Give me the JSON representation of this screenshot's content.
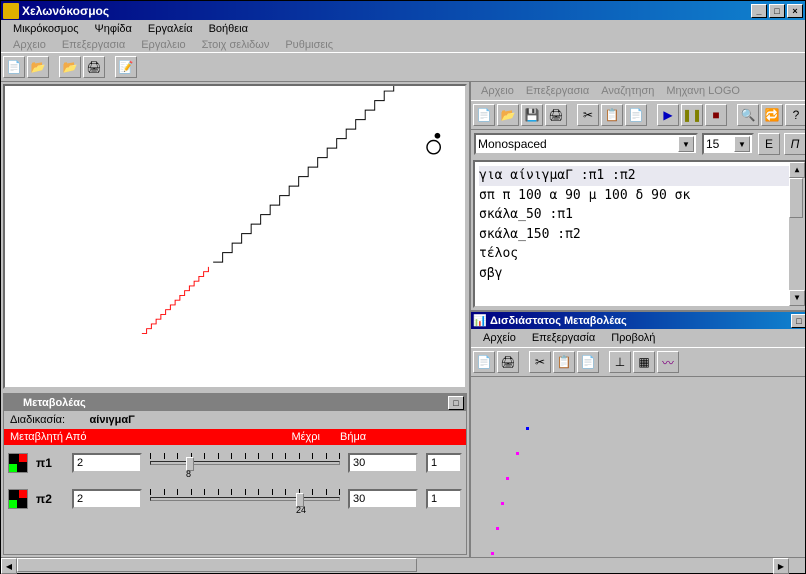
{
  "window": {
    "title": "Χελωνόκοσμος"
  },
  "menu1": [
    "Μικρόκοσμος",
    "Ψηφίδα",
    "Εργαλεία",
    "Βοήθεια"
  ],
  "menu2": [
    "Αρχειο",
    "Επεξεργασια",
    "Εργαλειο",
    "Στοιχ σελιδων",
    "Ρυθμισεις"
  ],
  "code": {
    "menu": [
      "Αρχειο",
      "Επεξεργασια",
      "Αναζητηση",
      "Μηχανη LOGO"
    ],
    "font_name": "Monospaced",
    "font_size": "15",
    "lines": [
      "για αίνιγμαΓ :π1 :π2",
      "σπ π 100 α 90 μ 100 δ 90 σκ",
      "σκάλα_50 :π1",
      "σκάλα_150 :π2",
      "τέλος",
      "",
      "σβγ"
    ]
  },
  "graph": {
    "title": "Δισδιάστατος Μεταβολέας",
    "menu": [
      "Αρχείο",
      "Επεξεργασία",
      "Προβολή"
    ]
  },
  "vars": {
    "title": "Μεταβολέας",
    "proc_label": "Διαδικασία:",
    "proc_name": "αίνιγμαΓ",
    "headers": [
      "Μεταβλητή Από",
      "Μέχρι",
      "Βήμα"
    ],
    "rows": [
      {
        "name": "π1",
        "from": "2",
        "to": "30",
        "step": "1",
        "value": 8
      },
      {
        "name": "π2",
        "from": "2",
        "to": "30",
        "step": "1",
        "value": 24
      }
    ]
  },
  "E": "E",
  "Pi": "Π"
}
